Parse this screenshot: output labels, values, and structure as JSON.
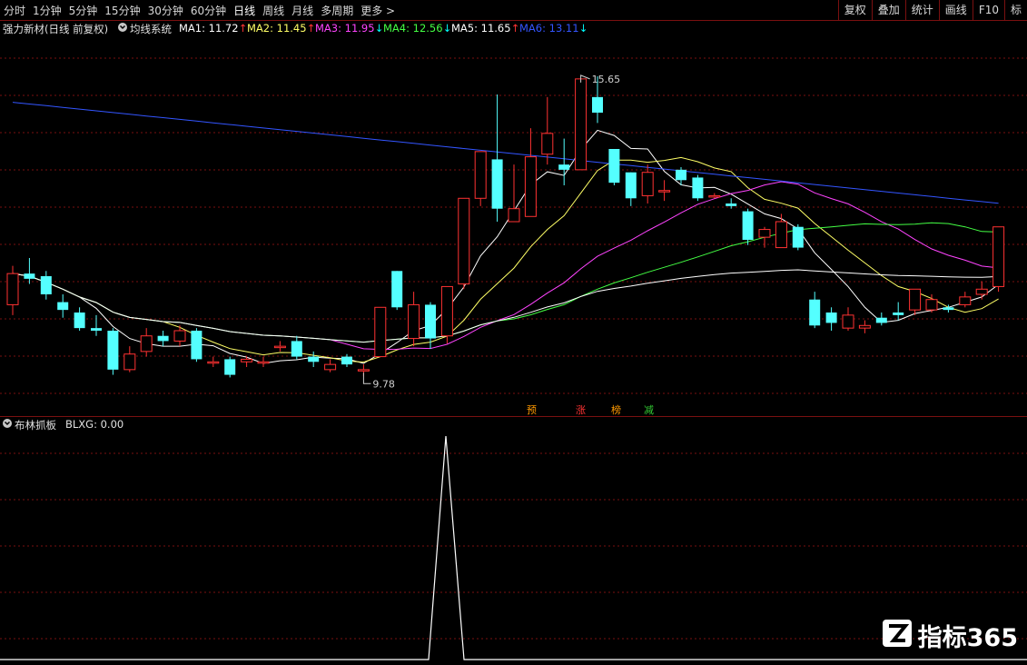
{
  "toolbar": {
    "periods": [
      "分时",
      "1分钟",
      "5分钟",
      "15分钟",
      "30分钟",
      "60分钟",
      "日线",
      "周线",
      "月线",
      "多周期",
      "更多 >"
    ],
    "active_period": "日线",
    "right_buttons": [
      "复权",
      "叠加",
      "统计",
      "画线",
      "F10",
      "标"
    ]
  },
  "main_info": {
    "stock": "强力新材(日线 前复权)",
    "indicator": "均线系统",
    "ma": [
      {
        "label": "MA1: 11.72",
        "arrow": "↑",
        "color": "#ffffff"
      },
      {
        "label": "MA2: 11.45",
        "arrow": "↑",
        "color": "#ffff66"
      },
      {
        "label": "MA3: 11.95",
        "arrow": "↓",
        "color": "#ff44ff"
      },
      {
        "label": "MA4: 12.56",
        "arrow": "↓",
        "color": "#44ff44"
      },
      {
        "label": "MA5: 11.65",
        "arrow": "↑",
        "color": "#ffffff"
      },
      {
        "label": "MA6: 13.11",
        "arrow": "↓",
        "color": "#3355ff"
      }
    ],
    "high_label": "15.65",
    "low_label": "9.78"
  },
  "flags": [
    {
      "text": "预",
      "color": "#ff9900"
    },
    {
      "text": "涨",
      "color": "#ff3333"
    },
    {
      "text": "榜",
      "color": "#ff9900"
    },
    {
      "text": "减",
      "color": "#33cc33"
    }
  ],
  "sub_info": {
    "name": "布林抓板",
    "value": "BLXG: 0.00"
  },
  "watermark": {
    "text": "指标365"
  },
  "colors": {
    "up": "#ff3232",
    "down": "#54ffff",
    "ma1": "#ffffff",
    "ma2": "#ffff66",
    "ma3": "#ff44ff",
    "ma4": "#44ff44",
    "ma6": "#3355ff",
    "grid": "#7a1010"
  },
  "chart_data": {
    "type": "candlestick",
    "price_range": [
      9.4,
      16.4
    ],
    "candles": [
      [
        11.3,
        11.9,
        11.1,
        12.05
      ],
      [
        11.9,
        11.8,
        11.7,
        12.2
      ],
      [
        11.85,
        11.5,
        11.4,
        11.95
      ],
      [
        11.35,
        11.2,
        11.05,
        11.5
      ],
      [
        11.15,
        10.85,
        10.8,
        11.25
      ],
      [
        10.85,
        10.8,
        10.7,
        11.1
      ],
      [
        10.8,
        10.05,
        9.95,
        10.85
      ],
      [
        10.05,
        10.35,
        10.0,
        10.5
      ],
      [
        10.4,
        10.7,
        10.3,
        10.85
      ],
      [
        10.7,
        10.6,
        10.5,
        10.8
      ],
      [
        10.6,
        10.8,
        10.5,
        10.9
      ],
      [
        10.8,
        10.25,
        10.2,
        10.85
      ],
      [
        10.2,
        10.2,
        10.1,
        10.3
      ],
      [
        10.25,
        9.95,
        9.9,
        10.3
      ],
      [
        10.2,
        10.25,
        10.1,
        10.3
      ],
      [
        10.2,
        10.2,
        10.1,
        10.3
      ],
      [
        10.5,
        10.5,
        10.4,
        10.6
      ],
      [
        10.6,
        10.3,
        10.25,
        10.7
      ],
      [
        10.3,
        10.2,
        10.1,
        10.4
      ],
      [
        10.05,
        10.15,
        10.0,
        10.25
      ],
      [
        10.3,
        10.15,
        10.1,
        10.35
      ],
      [
        10.05,
        10.05,
        9.92,
        10.15
      ],
      [
        10.3,
        11.25,
        10.3,
        11.25
      ],
      [
        11.95,
        11.25,
        11.2,
        11.95
      ],
      [
        10.65,
        11.3,
        10.5,
        11.55
      ],
      [
        11.3,
        10.65,
        10.45,
        11.35
      ],
      [
        10.7,
        11.65,
        10.55,
        11.65
      ],
      [
        11.7,
        13.35,
        11.6,
        13.35
      ],
      [
        13.35,
        14.25,
        13.2,
        14.25
      ],
      [
        14.1,
        13.15,
        12.9,
        15.35
      ],
      [
        12.9,
        13.15,
        12.9,
        14.0
      ],
      [
        13.0,
        14.15,
        13.0,
        14.7
      ],
      [
        14.2,
        14.6,
        14.0,
        15.3
      ],
      [
        14.0,
        13.9,
        13.6,
        14.5
      ],
      [
        13.9,
        15.65,
        13.9,
        15.65
      ],
      [
        15.3,
        15.0,
        14.8,
        15.7
      ],
      [
        14.3,
        13.65,
        13.6,
        14.3
      ],
      [
        13.85,
        13.35,
        13.2,
        13.85
      ],
      [
        13.4,
        13.85,
        13.25,
        14.0
      ],
      [
        13.5,
        13.5,
        13.3,
        13.7
      ],
      [
        13.9,
        13.7,
        13.6,
        13.95
      ],
      [
        13.75,
        13.35,
        13.3,
        13.8
      ],
      [
        13.4,
        13.4,
        13.35,
        13.45
      ],
      [
        13.25,
        13.2,
        13.15,
        13.35
      ],
      [
        13.1,
        12.55,
        12.45,
        13.15
      ],
      [
        12.6,
        12.75,
        12.4,
        12.8
      ],
      [
        12.4,
        12.9,
        12.4,
        13.05
      ],
      [
        12.8,
        12.4,
        12.35,
        12.85
      ],
      [
        11.4,
        10.9,
        10.85,
        11.55
      ],
      [
        11.15,
        10.95,
        10.8,
        11.25
      ],
      [
        10.85,
        11.1,
        10.8,
        11.25
      ],
      [
        10.85,
        10.9,
        10.75,
        11.0
      ],
      [
        11.05,
        10.95,
        10.9,
        11.15
      ],
      [
        11.15,
        11.1,
        11.0,
        11.35
      ],
      [
        11.2,
        11.6,
        11.1,
        11.6
      ],
      [
        11.2,
        11.4,
        11.15,
        11.5
      ],
      [
        11.25,
        11.2,
        11.15,
        11.3
      ],
      [
        11.3,
        11.45,
        11.25,
        11.55
      ],
      [
        11.5,
        11.6,
        11.4,
        11.75
      ],
      [
        11.65,
        12.8,
        11.55,
        12.8
      ]
    ]
  }
}
